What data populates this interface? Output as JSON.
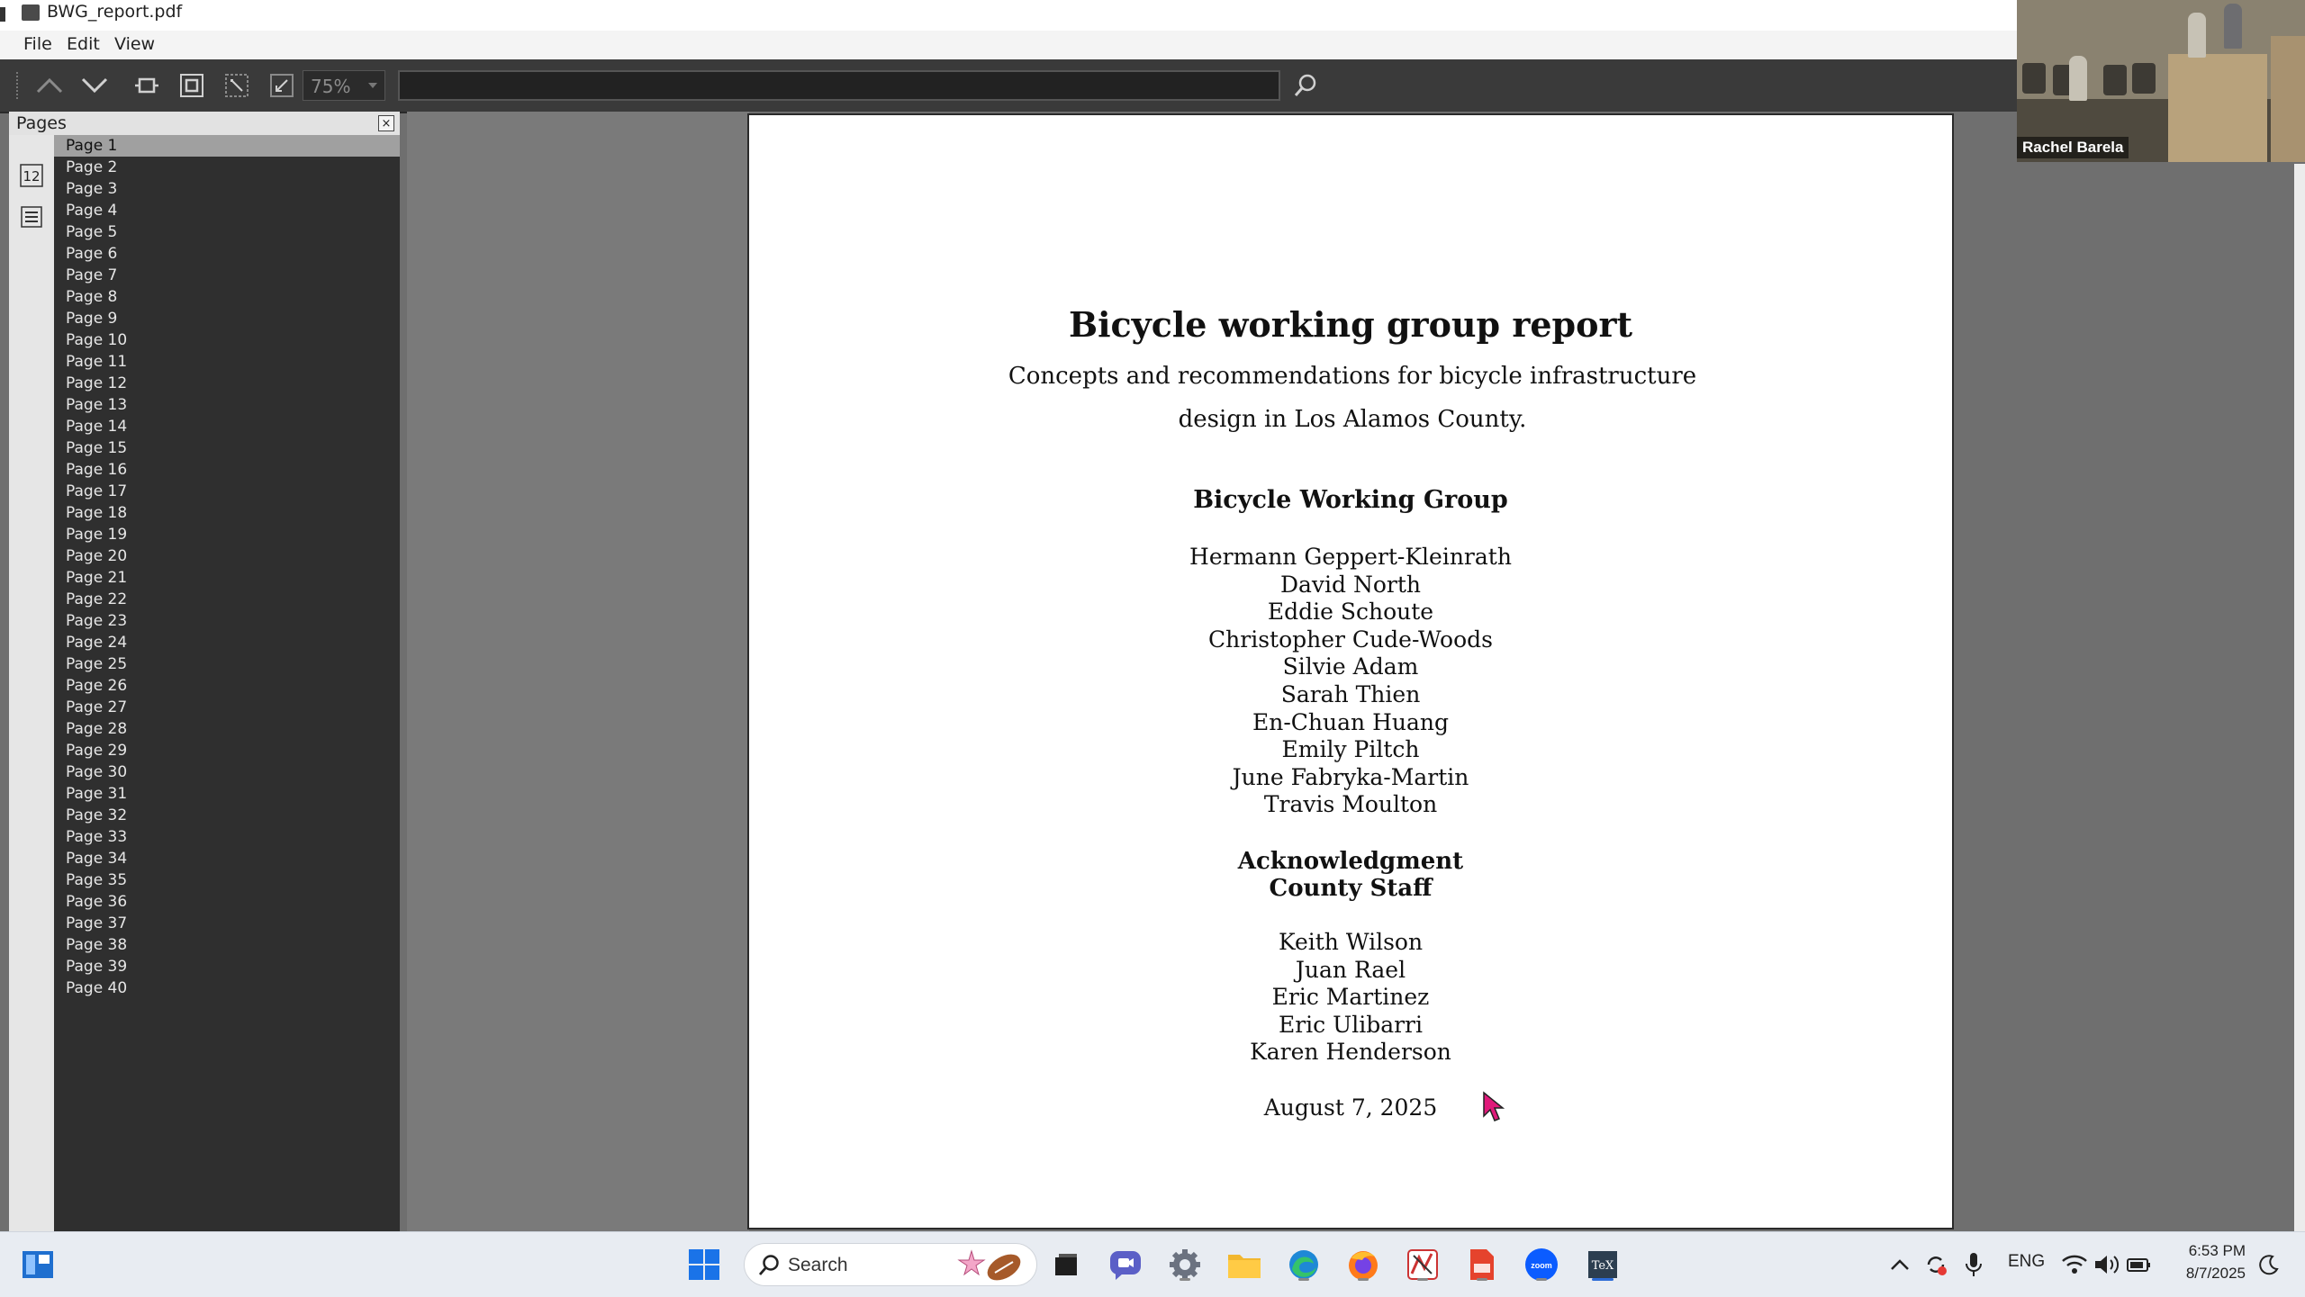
{
  "window": {
    "title": "BWG_report.pdf"
  },
  "menu": {
    "file": "File",
    "edit": "Edit",
    "view": "View"
  },
  "toolbar": {
    "zoom": "75%",
    "search_value": ""
  },
  "sidebar": {
    "title": "Pages",
    "pages": [
      "Page 1",
      "Page 2",
      "Page 3",
      "Page 4",
      "Page 5",
      "Page 6",
      "Page 7",
      "Page 8",
      "Page 9",
      "Page 10",
      "Page 11",
      "Page 12",
      "Page 13",
      "Page 14",
      "Page 15",
      "Page 16",
      "Page 17",
      "Page 18",
      "Page 19",
      "Page 20",
      "Page 21",
      "Page 22",
      "Page 23",
      "Page 24",
      "Page 25",
      "Page 26",
      "Page 27",
      "Page 28",
      "Page 29",
      "Page 30",
      "Page 31",
      "Page 32",
      "Page 33",
      "Page 34",
      "Page 35",
      "Page 36",
      "Page 37",
      "Page 38",
      "Page 39",
      "Page 40"
    ],
    "selected_index": 0
  },
  "document": {
    "title": "Bicycle working group report",
    "subtitle": "Concepts and recommendations for bicycle infrastructure design in Los Alamos County.",
    "group_heading": "Bicycle Working Group",
    "members": [
      "Hermann Geppert-Kleinrath",
      "David North",
      "Eddie Schoute",
      "Christopher Cude-Woods",
      "Silvie Adam",
      "Sarah Thien",
      "En-Chuan Huang",
      "Emily Piltch",
      "June Fabryka-Martin",
      "Travis Moulton"
    ],
    "ack_heading": "Acknowledgment",
    "staff_heading": "County Staff",
    "staff": [
      "Keith Wilson",
      "Juan Rael",
      "Eric Martinez",
      "Eric Ulibarri",
      "Karen Henderson"
    ],
    "date": "August 7, 2025"
  },
  "video": {
    "participant_name": "Rachel Barela"
  },
  "taskbar": {
    "search_label": "Search",
    "language": "ENG",
    "time": "6:53 PM",
    "date": "8/7/2025"
  },
  "colors": {
    "accent": "#2c6bd6",
    "cursor": "#e0197a",
    "toolbar": "#3a3a3a",
    "sidebar_list": "#2f2f2f"
  }
}
